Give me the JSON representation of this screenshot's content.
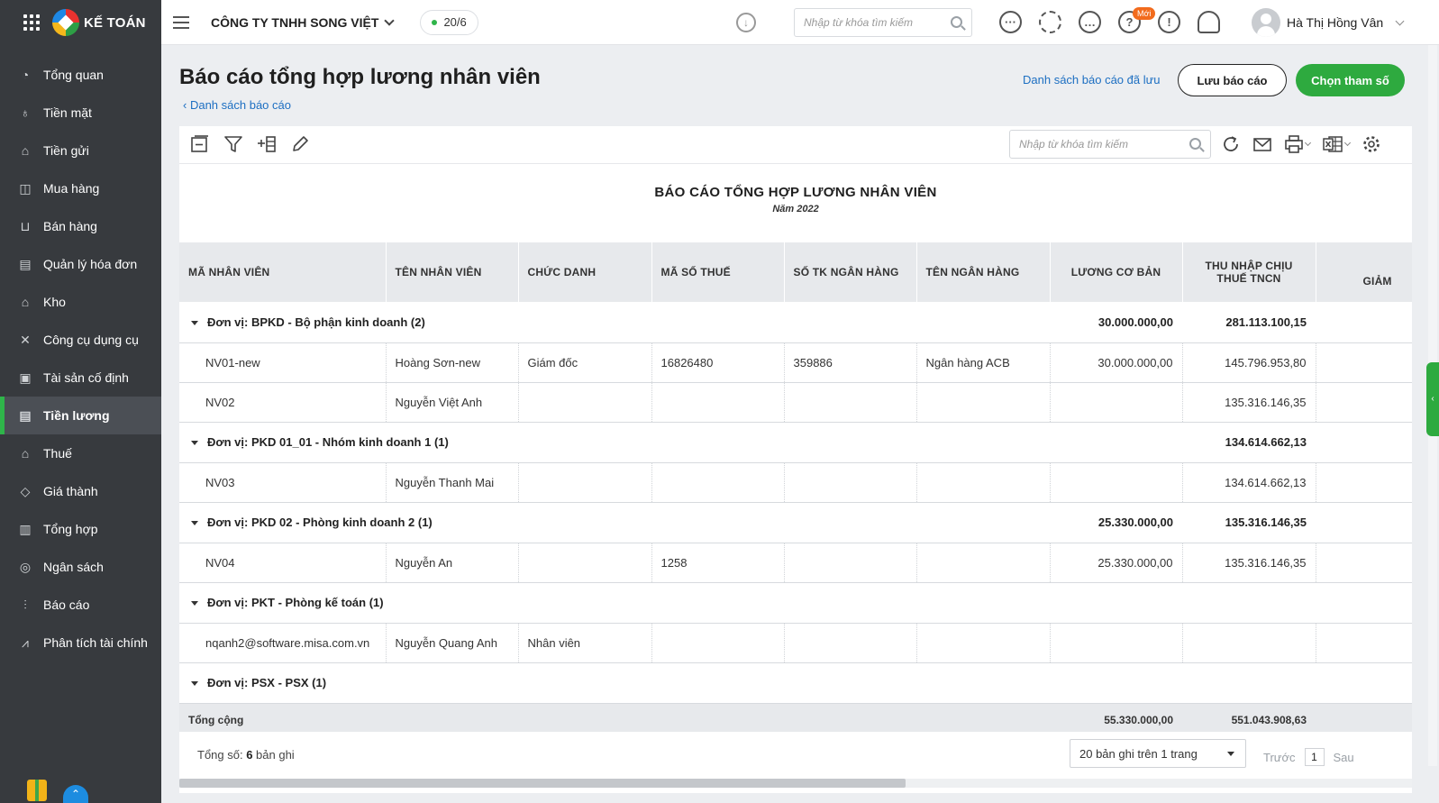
{
  "app": {
    "logo_text": "KẾ TOÁN",
    "company": "CÔNG TY TNHH SONG VIỆT",
    "date_badge": "20/6",
    "search_placeholder": "Nhập từ khóa tìm kiếm",
    "new_badge": "Mới",
    "user_name": "Hà Thị Hồng Vân",
    "accent_color": "#2eaa3f",
    "link_color": "#1d6fc2"
  },
  "sidebar": {
    "items": [
      {
        "label": "Tổng quan",
        "icon": "dashboard-icon"
      },
      {
        "label": "Tiền mặt",
        "icon": "cash-bag-icon"
      },
      {
        "label": "Tiền gửi",
        "icon": "bank-icon"
      },
      {
        "label": "Mua hàng",
        "icon": "shopping-bag-icon"
      },
      {
        "label": "Bán hàng",
        "icon": "cart-icon"
      },
      {
        "label": "Quản lý hóa đơn",
        "icon": "invoice-icon"
      },
      {
        "label": "Kho",
        "icon": "warehouse-icon"
      },
      {
        "label": "Công cụ dụng cụ",
        "icon": "tools-icon"
      },
      {
        "label": "Tài sản cố định",
        "icon": "asset-icon"
      },
      {
        "label": "Tiền lương",
        "icon": "payroll-icon"
      },
      {
        "label": "Thuế",
        "icon": "tax-icon"
      },
      {
        "label": "Giá thành",
        "icon": "price-tag-icon"
      },
      {
        "label": "Tổng hợp",
        "icon": "summary-icon"
      },
      {
        "label": "Ngân sách",
        "icon": "budget-icon"
      },
      {
        "label": "Báo cáo",
        "icon": "report-icon"
      },
      {
        "label": "Phân tích tài chính",
        "icon": "analytics-icon"
      }
    ],
    "active_index": 9
  },
  "page": {
    "title": "Báo cáo tổng hợp lương nhân viên",
    "back_link": "Danh sách báo cáo",
    "saved_reports_link": "Danh sách báo cáo đã lưu",
    "save_button": "Lưu báo cáo",
    "params_button": "Chọn tham số",
    "table_search_placeholder": "Nhập từ khóa tìm kiếm"
  },
  "report": {
    "title": "BÁO CÁO TỔNG HỢP LƯƠNG NHÂN VIÊN",
    "subtitle": "Năm 2022",
    "columns": [
      "MÃ NHÂN VIÊN",
      "TÊN NHÂN VIÊN",
      "CHỨC DANH",
      "MÃ SỐ THUẾ",
      "SỐ TK NGÂN HÀNG",
      "TÊN NGÂN HÀNG",
      "LƯƠNG CƠ BẢN",
      "THU NHẬP CHỊU THUẾ TNCN",
      "GIẢM"
    ],
    "rows": [
      {
        "type": "group",
        "label": "Đơn vị:  BPKD - Bộ phận kinh doanh  (2)",
        "salary": "30.000.000,00",
        "taxable": "281.113.100,15"
      },
      {
        "type": "row",
        "code": "NV01-new",
        "name": "Hoàng Sơn-new",
        "title": "Giám đốc",
        "tax_code": "16826480",
        "bank_acc": "359886",
        "bank": "Ngân hàng ACB",
        "salary": "30.000.000,00",
        "taxable": "145.796.953,80"
      },
      {
        "type": "row",
        "code": "NV02",
        "name": "Nguyễn Việt Anh",
        "title": "",
        "tax_code": "",
        "bank_acc": "",
        "bank": "",
        "salary": "",
        "taxable": "135.316.146,35"
      },
      {
        "type": "group",
        "label": "Đơn vị:  PKD 01_01 - Nhóm kinh doanh 1  (1)",
        "salary": "",
        "taxable": "134.614.662,13"
      },
      {
        "type": "row",
        "code": "NV03",
        "name": "Nguyễn Thanh Mai",
        "title": "",
        "tax_code": "",
        "bank_acc": "",
        "bank": "",
        "salary": "",
        "taxable": "134.614.662,13"
      },
      {
        "type": "group",
        "label": "Đơn vị:  PKD 02 - Phòng kinh doanh 2  (1)",
        "salary": "25.330.000,00",
        "taxable": "135.316.146,35"
      },
      {
        "type": "row",
        "code": "NV04",
        "name": "Nguyễn An",
        "title": "",
        "tax_code": "1258",
        "bank_acc": "",
        "bank": "",
        "salary": "25.330.000,00",
        "taxable": "135.316.146,35"
      },
      {
        "type": "group",
        "label": "Đơn vị:  PKT - Phòng kế toán  (1)",
        "salary": "",
        "taxable": ""
      },
      {
        "type": "row",
        "code": "nqanh2@software.misa.com.vn",
        "name": "Nguyễn Quang Anh",
        "title": "Nhân viên",
        "tax_code": "",
        "bank_acc": "",
        "bank": "",
        "salary": "",
        "taxable": ""
      },
      {
        "type": "group",
        "label": "Đơn vị:  PSX - PSX  (1)",
        "salary": "",
        "taxable": ""
      }
    ],
    "total": {
      "label": "Tổng cộng",
      "salary": "55.330.000,00",
      "taxable": "551.043.908,63"
    }
  },
  "footer": {
    "total_prefix": "Tổng số: ",
    "total_count": "6",
    "total_suffix": " bản ghi",
    "page_size": "20 bản ghi trên 1 trang",
    "prev": "Trước",
    "page": "1",
    "next": "Sau"
  }
}
